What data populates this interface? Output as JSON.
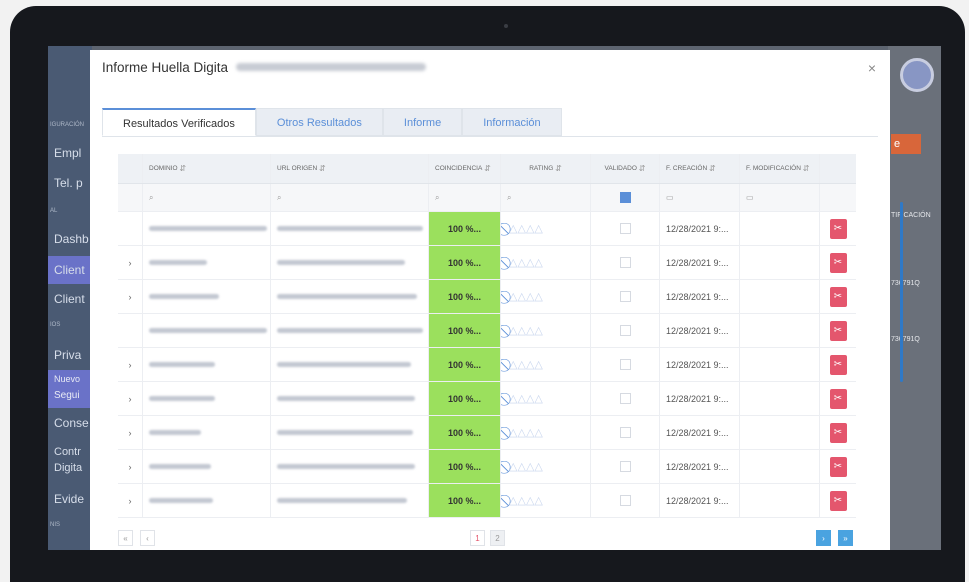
{
  "background": {
    "sidebar_items": [
      "Empl",
      "Tel. p",
      "Dashb",
      "Client",
      "Client",
      "Priva",
      "Nuevo",
      "Segui",
      "Conse",
      "Contr",
      "Digita",
      "Evide"
    ],
    "sidebar_sections": [
      "IGURACIÓN",
      "AL",
      "IOS",
      "NIS"
    ],
    "right_texts": [
      "TIFICACIÓN",
      "736791Q",
      "736791Q"
    ]
  },
  "modal": {
    "title": "Informe Huella Digita",
    "close": "×"
  },
  "tabs": [
    {
      "label": "Resultados Verificados",
      "active": true
    },
    {
      "label": "Otros Resultados",
      "active": false
    },
    {
      "label": "Informe",
      "active": false
    },
    {
      "label": "Información",
      "active": false
    }
  ],
  "grid": {
    "headers": [
      "DOMINIO",
      "URL ORIGEN",
      "COINCIDENCIA",
      "RATING",
      "VALIDADO",
      "F. CREACIÓN",
      "F. MODIFICACIÓN"
    ],
    "rows": [
      {
        "expand": "",
        "coincidencia": "100 %...",
        "fecha": "12/28/2021 9:..."
      },
      {
        "expand": "›",
        "coincidencia": "100 %...",
        "fecha": "12/28/2021 9:..."
      },
      {
        "expand": "›",
        "coincidencia": "100 %...",
        "fecha": "12/28/2021 9:..."
      },
      {
        "expand": "",
        "coincidencia": "100 %...",
        "fecha": "12/28/2021 9:..."
      },
      {
        "expand": "›",
        "coincidencia": "100 %...",
        "fecha": "12/28/2021 9:..."
      },
      {
        "expand": "›",
        "coincidencia": "100 %...",
        "fecha": "12/28/2021 9:..."
      },
      {
        "expand": "›",
        "coincidencia": "100 %...",
        "fecha": "12/28/2021 9:..."
      },
      {
        "expand": "›",
        "coincidencia": "100 %...",
        "fecha": "12/28/2021 9:..."
      },
      {
        "expand": "›",
        "coincidencia": "100 %...",
        "fecha": "12/28/2021 9:..."
      }
    ]
  },
  "pager": {
    "pages": [
      "1",
      "2"
    ]
  },
  "colors": {
    "accent": "#5b8fd8",
    "match": "#9be05d",
    "delete": "#e4566d"
  }
}
